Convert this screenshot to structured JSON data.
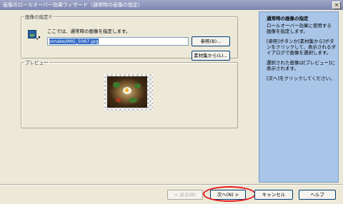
{
  "window": {
    "title": "画像のロールオーバー効果ウィザード（通常時の画像の指定）",
    "close_glyph": "×"
  },
  "image_group": {
    "legend": "画像の指定①",
    "description": "ここでは、通常時の画像を指定します。",
    "path_value": "omake/IMG_5067.jpg",
    "browse_label": "参照(B)...",
    "library_label": "素材集から(L)..."
  },
  "preview_group": {
    "legend": "プレビュー"
  },
  "sidebar": {
    "title": "通常時の画像の指定",
    "paragraphs": [
      "ロールオーバー効果に使用する画像を指定します。",
      "[参照]ボタンか[素材集から]ボタンをクリックして、表示されるダイアログで画像を選択します。",
      "選択された画像は[プレビュー]に表示されます。",
      "[次へ]をクリックしてください。"
    ]
  },
  "footer": {
    "back_label": "< 戻る(B)",
    "next_label": "次へ(N) >",
    "cancel_label": "キャンセル",
    "help_label": "ヘルプ"
  },
  "colors": {
    "dialog_bg": "#ece9d8",
    "sidebar_bg": "#a9c5e8",
    "selection": "#316ac5",
    "highlight_ring": "#e8151b"
  },
  "icons": [
    "picture-icon",
    "mouse-cursor-icon",
    "close-icon"
  ]
}
